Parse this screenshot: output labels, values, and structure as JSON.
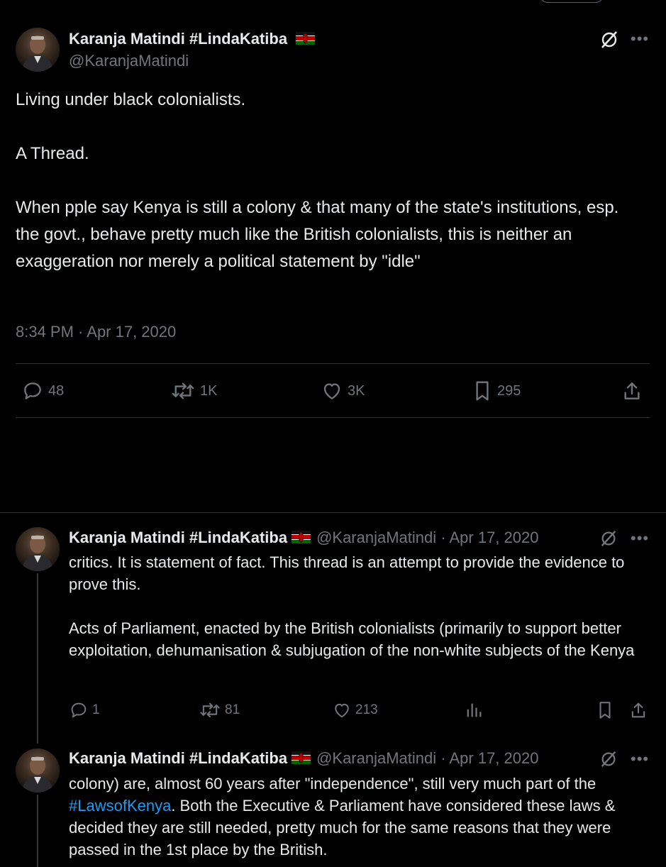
{
  "main_tweet": {
    "author_name": "Karanja Matindi #LindaKatiba",
    "author_handle": "@KaranjaMatindi",
    "flag_icon": "kenya-flag-icon",
    "paragraphs": [
      "Living under black colonialists.",
      "A Thread.",
      "When pple say Kenya is still a colony & that many of the state's institutions, esp. the govt., behave pretty much like the British colonialists, this is neither an exaggeration nor merely a political statement by \"idle\""
    ],
    "timestamp": "8:34 PM · Apr 17, 2020",
    "stats": {
      "replies": "48",
      "retweets": "1K",
      "likes": "3K",
      "bookmarks": "295"
    }
  },
  "replies": [
    {
      "author_name": "Karanja Matindi #LindaKatiba",
      "meta": "@KaranjaMatindi · Apr 17, 2020",
      "paragraphs": [
        "critics. It is statement of fact. This thread is an attempt to provide the evidence to prove this.",
        "Acts of Parliament, enacted by the British colonialists (primarily to support better exploitation, dehumanisation & subjugation of the non-white subjects of the Kenya"
      ],
      "stats": {
        "replies": "1",
        "retweets": "81",
        "likes": "213"
      }
    },
    {
      "author_name": "Karanja Matindi #LindaKatiba",
      "meta": "@KaranjaMatindi · Apr 17, 2020",
      "text_before": "colony) are, almost 60 years after \"independence\", still very much part of the ",
      "hashtag": "#LawsofKenya",
      "text_after": ". Both the Executive & Parliament have considered these laws & decided they are still needed, pretty much for the same reasons that they were passed in the 1st place by the British."
    }
  ],
  "colors": {
    "background": "#000000",
    "text_primary": "#e7e9ea",
    "text_secondary": "#71767b",
    "divider": "#2f3336",
    "link": "#1d9bf0"
  }
}
